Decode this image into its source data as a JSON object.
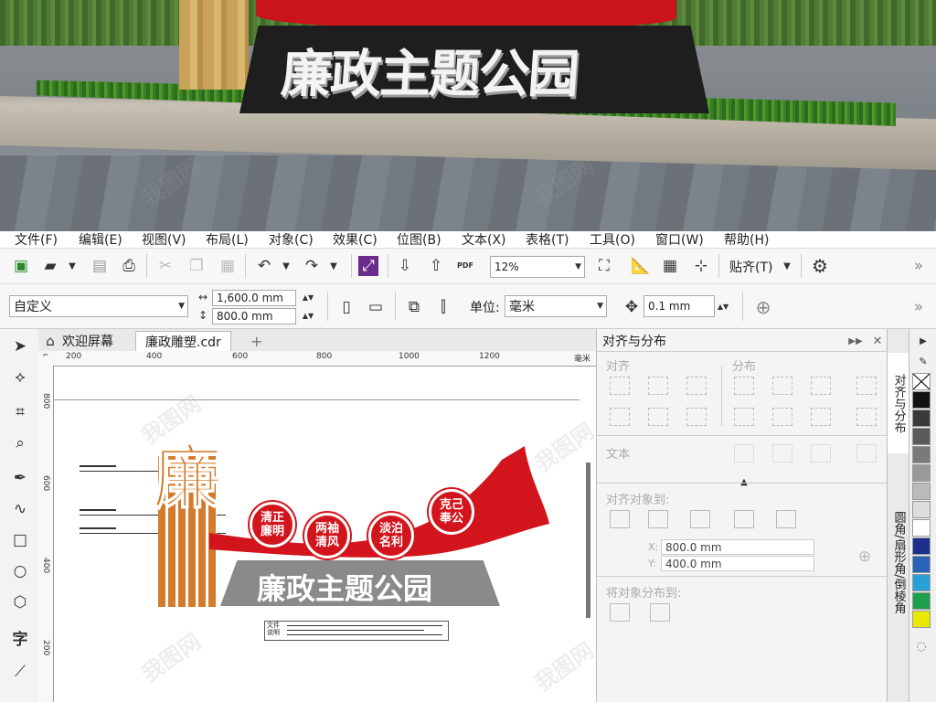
{
  "render": {
    "sign_text": "廉政主题公园"
  },
  "menu": [
    "文件(F)",
    "编辑(E)",
    "视图(V)",
    "布局(L)",
    "对象(C)",
    "效果(C)",
    "位图(B)",
    "文本(X)",
    "表格(T)",
    "工具(O)",
    "窗口(W)",
    "帮助(H)"
  ],
  "toolbar": {
    "zoom": "12%",
    "snap_label": "贴齐(T)",
    "pdf_label": "PDF"
  },
  "property_bar": {
    "page_preset": "自定义",
    "width": "1,600.0 mm",
    "height": "800.0 mm",
    "unit_label": "单位:",
    "unit_value": "毫米",
    "nudge": "0.1 mm"
  },
  "tabs": {
    "welcome": "欢迎屏幕",
    "document": "廉政雕塑.cdr",
    "add": "+"
  },
  "ruler": {
    "h_ticks": [
      "200",
      "400",
      "600",
      "800",
      "1000",
      "1200"
    ],
    "unit": "毫米",
    "v_ticks": [
      "800",
      "600",
      "400",
      "200"
    ]
  },
  "design": {
    "big_char": "廉",
    "title": "廉政主题公园",
    "circles": [
      "清正\n廉明",
      "两袖\n清风",
      "淡泊\n名利",
      "克己\n奉公"
    ],
    "note_label": "文件\n说明"
  },
  "docker": {
    "title": "对齐与分布",
    "align": "对齐",
    "distribute": "分布",
    "text": "文本",
    "align_to": "对齐对象到:",
    "x_label": "X:",
    "x_value": "800.0 mm",
    "y_label": "Y:",
    "y_value": "400.0 mm",
    "distribute_to": "将对象分布到:"
  },
  "side_tabs": {
    "align_tab": "对齐与分布",
    "corner_tab": "圆角/扇形角/倒棱角"
  },
  "palette": [
    "#ffffff",
    "#000000",
    "#3a3a3a",
    "#5a5a5a",
    "#7a7a7a",
    "#999999",
    "#bbbbbb",
    "#dddddd",
    "#ffffff",
    "#1c2f8c",
    "#2b63b8",
    "#2aa0d8",
    "#1ea04a",
    "#e8e800"
  ],
  "watermark": "我图网"
}
